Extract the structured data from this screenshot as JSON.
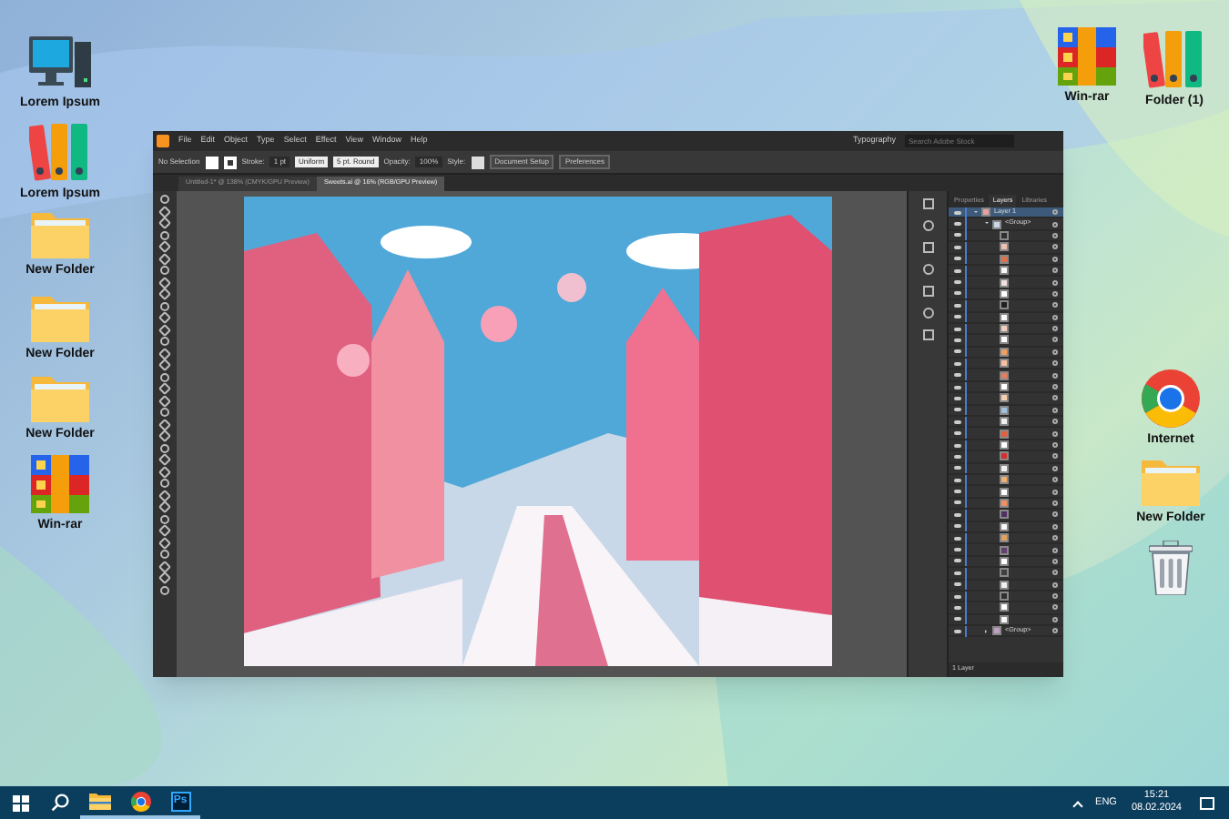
{
  "desktop_icons_left": [
    {
      "kind": "computer",
      "label": "Lorem Ipsum"
    },
    {
      "kind": "binders",
      "label": "Lorem Ipsum"
    },
    {
      "kind": "folder",
      "label": "New Folder"
    },
    {
      "kind": "folder",
      "label": "New Folder"
    },
    {
      "kind": "folder",
      "label": "New Folder"
    },
    {
      "kind": "winrar",
      "label": "Win-rar"
    }
  ],
  "desktop_icons_top_right": [
    {
      "kind": "winrar",
      "label": "Win-rar"
    },
    {
      "kind": "binders",
      "label": "Folder (1)"
    }
  ],
  "desktop_icons_right": [
    {
      "kind": "chrome",
      "label": "Internet"
    },
    {
      "kind": "folder",
      "label": "New Folder"
    },
    {
      "kind": "trash"
    }
  ],
  "app": {
    "menu": [
      "File",
      "Edit",
      "Object",
      "Type",
      "Select",
      "Effect",
      "View",
      "Window",
      "Help"
    ],
    "workspace": "Typography",
    "search_placeholder": "Search Adobe Stock",
    "control_bar": {
      "selection": "No Selection",
      "stroke_label": "Stroke:",
      "stroke_weight": "1 pt",
      "profile": "Uniform",
      "brush": "5 pt. Round",
      "opacity_label": "Opacity:",
      "opacity": "100%",
      "style_label": "Style:",
      "buttons": [
        "Document Setup",
        "Preferences"
      ]
    },
    "doc_tabs": [
      {
        "title": "Untitled-1* @ 138% (CMYK/GPU Preview)",
        "selected": false
      },
      {
        "title": "Sweets.ai @ 16% (RGB/GPU Preview)",
        "selected": true
      }
    ],
    "panel_tabs": [
      {
        "label": "Properties",
        "selected": false
      },
      {
        "label": "Layers",
        "selected": true
      },
      {
        "label": "Libraries",
        "selected": false
      }
    ],
    "layers": [
      {
        "name": "Layer 1",
        "selected": true,
        "expanded": true,
        "color": "#e8a0a0"
      },
      {
        "name": "<Group>",
        "selected": false,
        "expanded": true,
        "color": "#c8d8e8"
      },
      {
        "color": "#303030"
      },
      {
        "color": "#f0c0b0"
      },
      {
        "color": "#e07050"
      },
      {
        "color": "#f8f8f8"
      },
      {
        "color": "#f0e0e0"
      },
      {
        "color": "#ffffff"
      },
      {
        "color": "#202020"
      },
      {
        "color": "#f8f8f8"
      },
      {
        "color": "#f0d0c0"
      },
      {
        "color": "#ffffff"
      },
      {
        "color": "#f0a060"
      },
      {
        "color": "#f8c0a0"
      },
      {
        "color": "#e08060"
      },
      {
        "color": "#ffffff"
      },
      {
        "color": "#f8d0b0"
      },
      {
        "color": "#a0c0e0"
      },
      {
        "color": "#f0f0f0"
      },
      {
        "color": "#e06040"
      },
      {
        "color": "#ffffff"
      },
      {
        "color": "#d03030"
      },
      {
        "color": "#f0f0f0"
      },
      {
        "color": "#f0b070"
      },
      {
        "color": "#ffffff"
      },
      {
        "color": "#f09060"
      },
      {
        "color": "#503060"
      },
      {
        "color": "#f8f8f8"
      },
      {
        "color": "#e0a060"
      },
      {
        "color": "#604070"
      },
      {
        "color": "#ffffff"
      },
      {
        "color": "#404040"
      },
      {
        "color": "#f0f0f0"
      },
      {
        "color": "#303030"
      },
      {
        "color": "#ffffff"
      },
      {
        "color": "#f8f8f8"
      },
      {
        "name": "<Group>",
        "selected": false,
        "expanded": false,
        "color": "#c0a0c0"
      }
    ],
    "layers_footer": "1 Layer"
  },
  "taskbar": {
    "pinned": [
      {
        "kind": "search",
        "running": false
      },
      {
        "kind": "explorer",
        "running": true
      },
      {
        "kind": "chrome",
        "running": true
      },
      {
        "kind": "photoshop",
        "label": "Ps",
        "running": true
      }
    ],
    "language": "ENG",
    "time": "15:21",
    "date": "08.02.2024"
  }
}
